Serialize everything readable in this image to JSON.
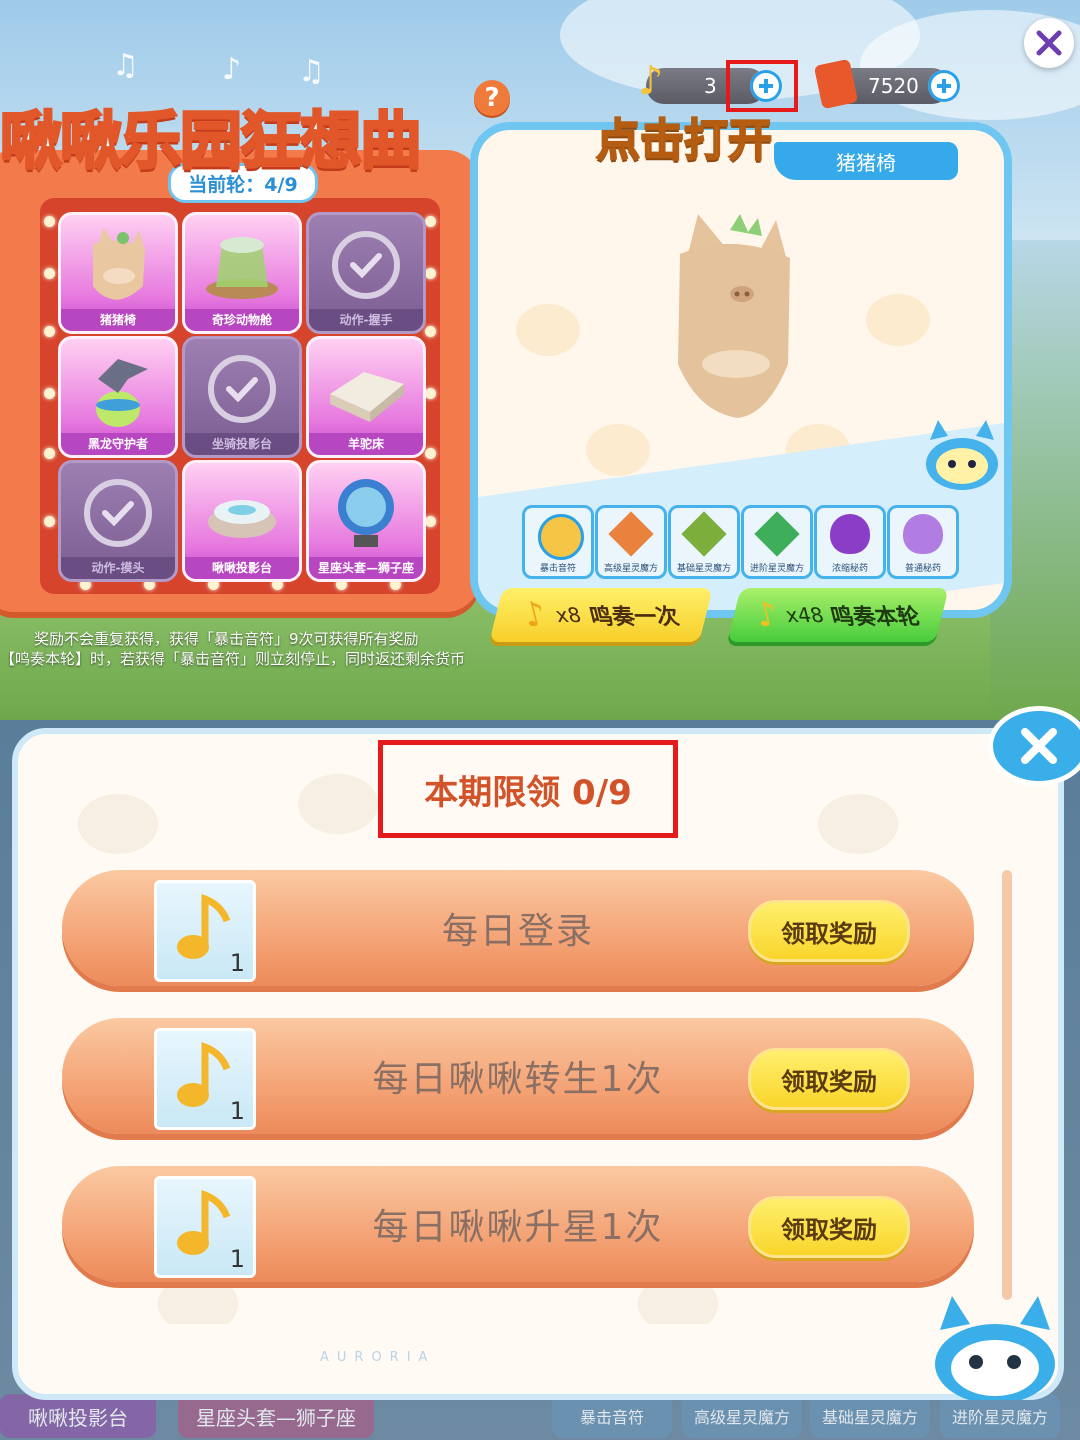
{
  "top": {
    "title": "啾啾乐园狂想曲",
    "help": "?",
    "round_label": "当前轮：4/9",
    "currency": {
      "notes": "3",
      "tickets": "7520"
    },
    "tap_open": "点击打开",
    "preview_name": "猪猪椅",
    "grid": [
      {
        "label": "猪猪椅",
        "state": "active"
      },
      {
        "label": "奇珍动物舱",
        "state": "active"
      },
      {
        "label": "动作-握手",
        "state": "claimed"
      },
      {
        "label": "黑龙守护者",
        "state": "active"
      },
      {
        "label": "坐骑投影台",
        "state": "claimed"
      },
      {
        "label": "羊驼床",
        "state": "active"
      },
      {
        "label": "动作-摸头",
        "state": "claimed"
      },
      {
        "label": "啾啾投影台",
        "state": "active"
      },
      {
        "label": "星座头套—狮子座",
        "state": "active"
      }
    ],
    "reward_items": [
      "暴击音符",
      "高级星灵魔方",
      "基础星灵魔方",
      "进阶星灵魔方",
      "浓缩秘药",
      "普通秘药"
    ],
    "play_once": {
      "cost": "x8",
      "label": "鸣奏一次"
    },
    "play_round": {
      "cost": "x48",
      "label": "鸣奏本轮"
    },
    "info_line1": "奖励不会重复获得，获得「暴击音符」9次可获得所有奖励",
    "info_line2": "【鸣奏本轮】时，若获得「暴击音符」则立刻停止，同时返还剩余货币"
  },
  "bottom": {
    "limit_label": "本期限领 0/9",
    "tasks": [
      {
        "label": "每日登录",
        "qty": "1",
        "button": "领取奖励"
      },
      {
        "label": "每日啾啾转生1次",
        "qty": "1",
        "button": "领取奖励"
      },
      {
        "label": "每日啾啾升星1次",
        "qty": "1",
        "button": "领取奖励"
      }
    ],
    "brand": "AURORIA",
    "bg_tags": [
      "啾啾投影台",
      "星座头套—狮子座",
      "暴击音符",
      "高级星灵魔方",
      "基础星灵魔方",
      "进阶星灵魔方"
    ]
  },
  "colors": {
    "accent_orange": "#f37a4a",
    "accent_blue": "#39aee9",
    "highlight_red": "#e51b1b",
    "claim_yellow": "#f9d52b"
  }
}
